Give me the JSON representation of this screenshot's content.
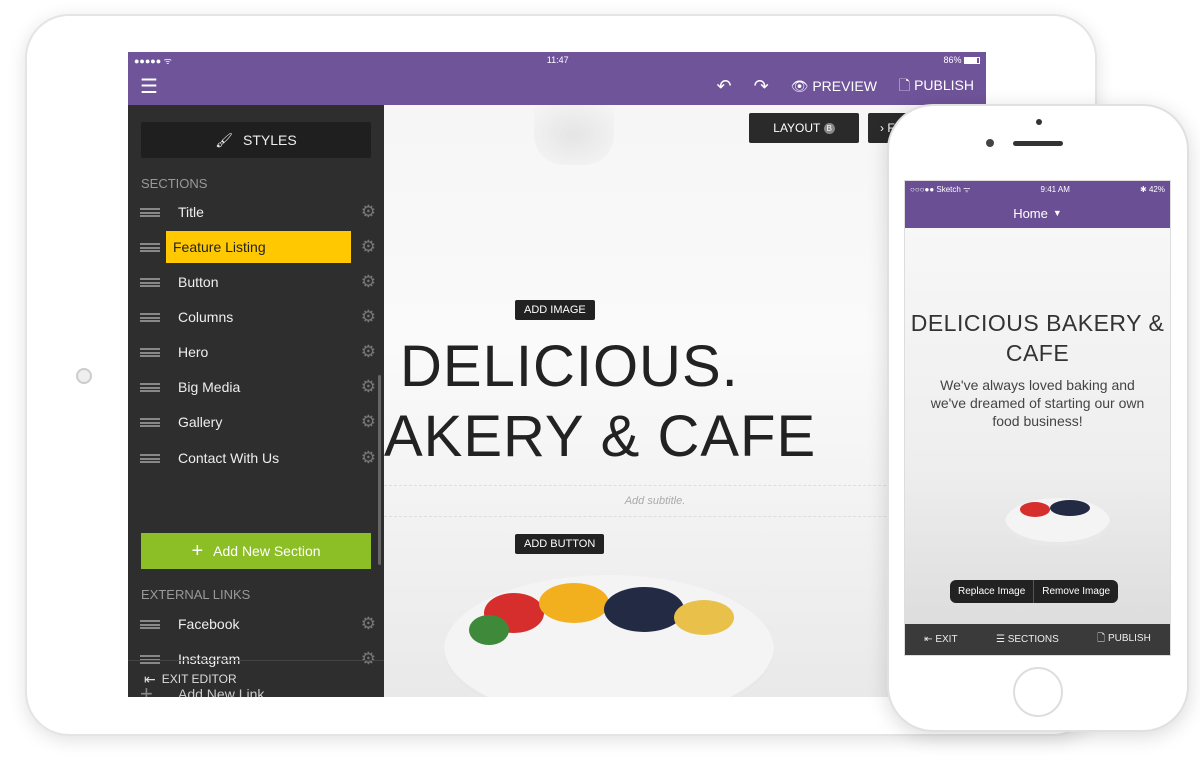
{
  "tablet": {
    "status": {
      "signal": "●●●●● ᯤ",
      "time": "11:47",
      "battery": "86%"
    },
    "toolbar": {
      "menu_icon": "hamburger-icon",
      "undo_icon": "undo-icon",
      "redo_icon": "redo-icon",
      "preview": "PREVIEW",
      "publish": "PUBLISH"
    },
    "sidebar": {
      "styles": "STYLES",
      "sections_heading": "SECTIONS",
      "sections": [
        {
          "label": "Title"
        },
        {
          "label": "Feature Listing",
          "active": true
        },
        {
          "label": "Button"
        },
        {
          "label": "Columns"
        },
        {
          "label": "Hero"
        },
        {
          "label": "Big Media"
        },
        {
          "label": "Gallery"
        },
        {
          "label": "Contact With Us"
        }
      ],
      "add_section": "Add New Section",
      "external_heading": "EXTERNAL LINKS",
      "links": [
        {
          "label": "Facebook"
        },
        {
          "label": "Instagram"
        }
      ],
      "add_link": "Add New Link",
      "exit": "EXIT EDITOR"
    },
    "canvas": {
      "layout_button": "LAYOUT",
      "layout_badge": "B",
      "next_button": "› F",
      "add_image": "ADD IMAGE",
      "title_line1": "DELICIOUS.",
      "title_line2": "AKERY & CAFE",
      "subtitle_placeholder": "Add subtitle.",
      "add_button": "ADD BUTTON"
    }
  },
  "phone": {
    "status": {
      "carrier": "○○○●● Sketch ᯤ",
      "time": "9:41 AM",
      "battery": "✱ 42%"
    },
    "nav_title": "Home",
    "title": "DELICIOUS BAKERY & CAFE",
    "subtitle": "We've always loved baking and we've dreamed of starting our own food business!",
    "popover": {
      "replace": "Replace Image",
      "remove": "Remove Image"
    },
    "bottom_bar": {
      "exit": "EXIT",
      "sections": "SECTIONS",
      "publish": "PUBLISH"
    }
  },
  "colors": {
    "brand_purple": "#6f5499",
    "highlight": "#ffc800",
    "add_green": "#8cbf26",
    "sidebar_bg": "#2e2e2e"
  }
}
